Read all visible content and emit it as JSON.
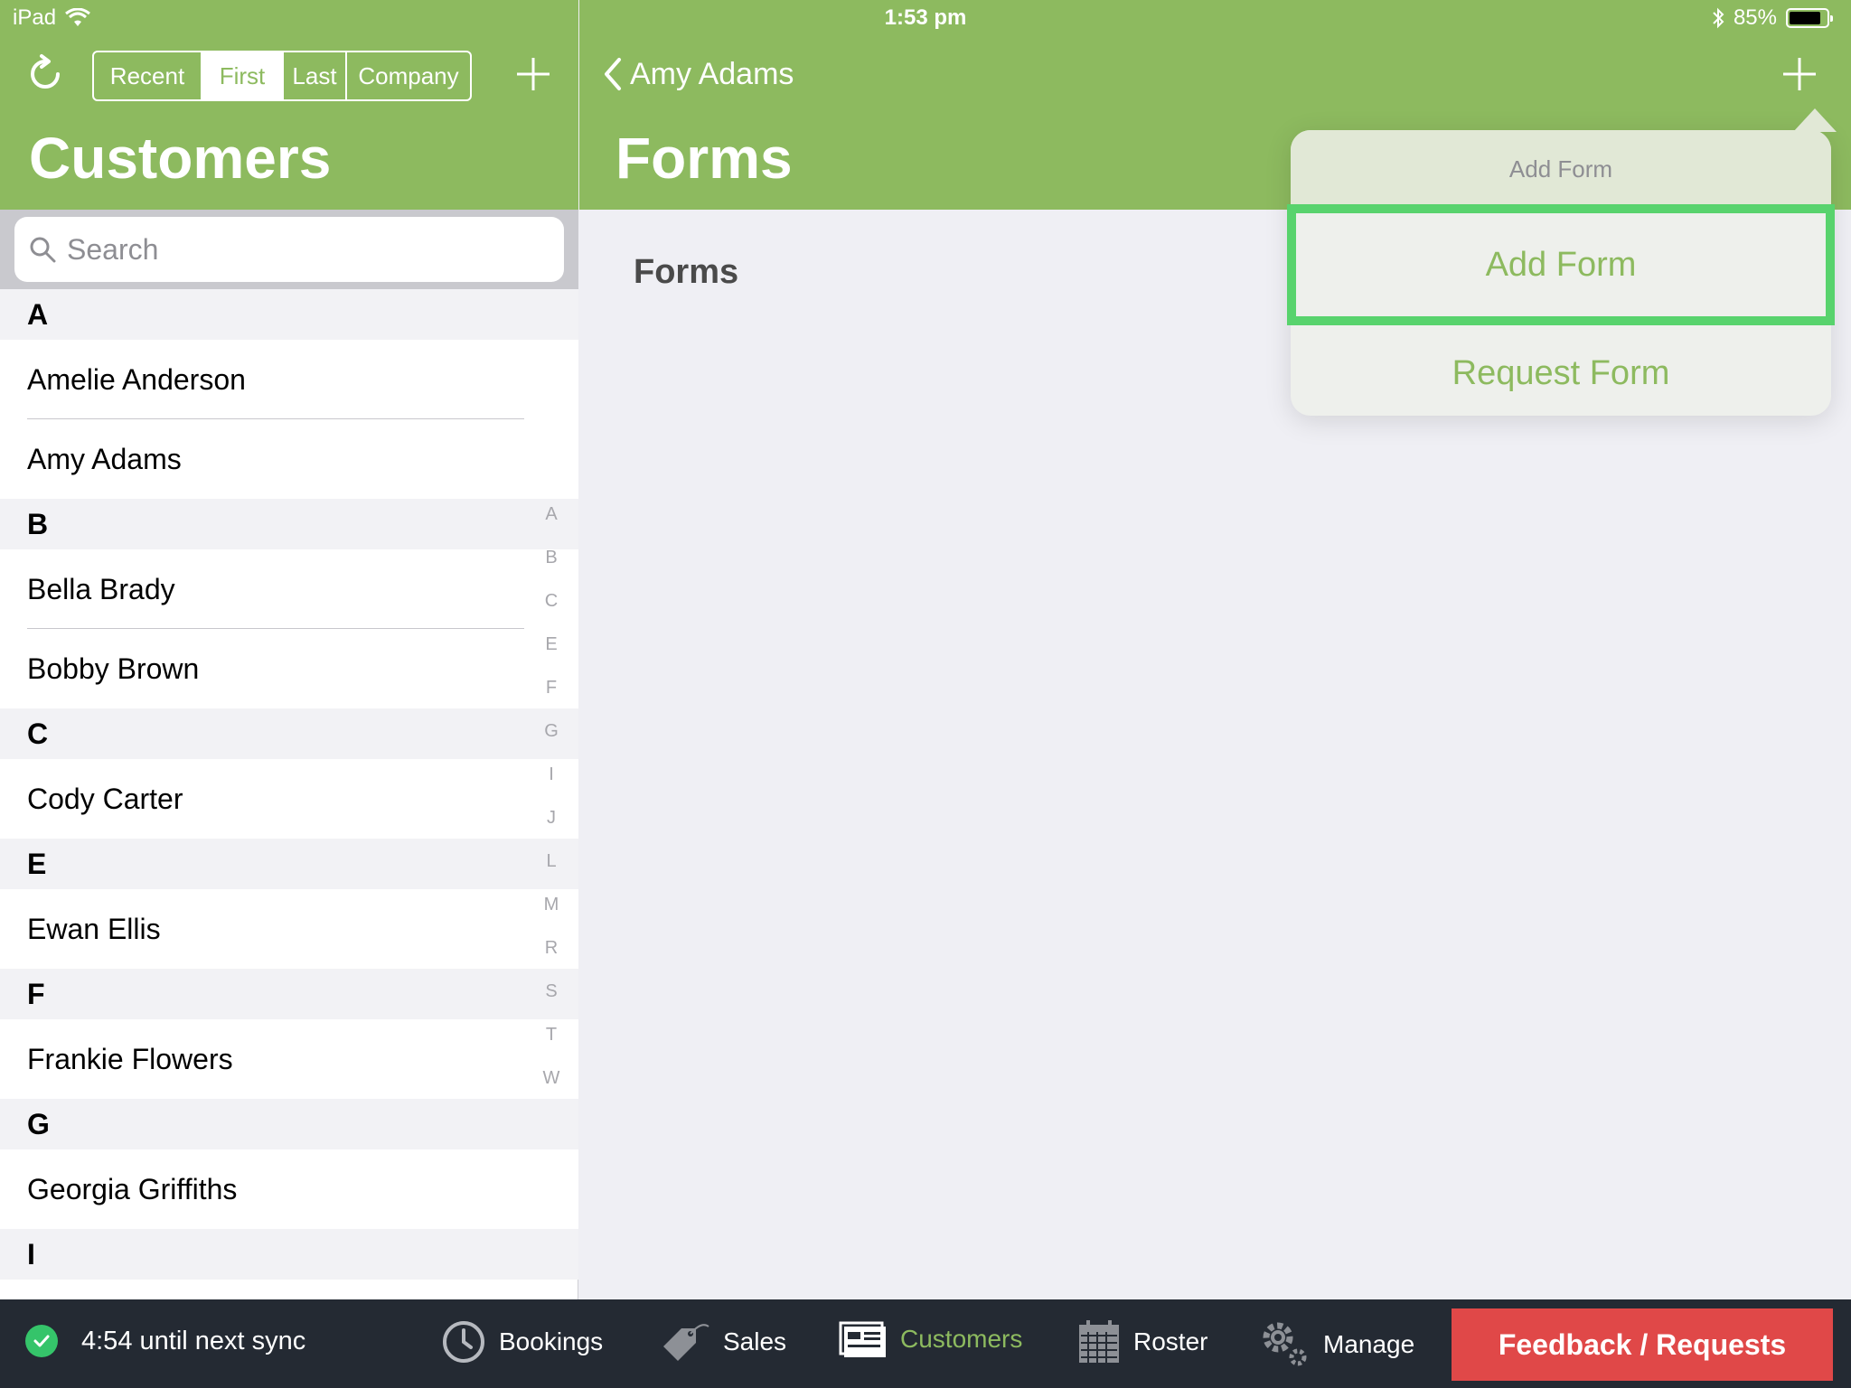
{
  "status_bar": {
    "device": "iPad",
    "time": "1:53 pm",
    "battery_percent": "85%",
    "battery_level": 0.85
  },
  "left": {
    "segments": [
      "Recent",
      "First",
      "Last",
      "Company"
    ],
    "selected_segment": "First",
    "title": "Customers",
    "search_placeholder": "Search",
    "sections": [
      {
        "letter": "A",
        "rows": [
          "Amelie Anderson",
          "Amy Adams"
        ]
      },
      {
        "letter": "B",
        "rows": [
          "Bella Brady",
          "Bobby Brown"
        ]
      },
      {
        "letter": "C",
        "rows": [
          "Cody  Carter"
        ]
      },
      {
        "letter": "E",
        "rows": [
          "Ewan Ellis"
        ]
      },
      {
        "letter": "F",
        "rows": [
          "Frankie Flowers"
        ]
      },
      {
        "letter": "G",
        "rows": [
          "Georgia Griffiths"
        ]
      },
      {
        "letter": "I",
        "rows": []
      }
    ],
    "index_letters": [
      "A",
      "B",
      "C",
      "E",
      "F",
      "G",
      "I",
      "J",
      "L",
      "M",
      "R",
      "S",
      "T",
      "W"
    ]
  },
  "right": {
    "back_label": "Amy Adams",
    "title": "Forms",
    "section_label": "Forms"
  },
  "popover": {
    "title": "Add Form",
    "options": [
      "Add Form",
      "Request Form"
    ]
  },
  "bottom_bar": {
    "sync_text": "4:54 until next sync",
    "tabs": [
      {
        "label": "Bookings",
        "icon": "clock-icon"
      },
      {
        "label": "Sales",
        "icon": "price-tag-icon"
      },
      {
        "label": "Customers",
        "icon": "customers-card-icon"
      },
      {
        "label": "Roster",
        "icon": "calendar-icon"
      },
      {
        "label": "Manage",
        "icon": "gears-icon"
      }
    ],
    "active_tab": "Customers",
    "feedback_label": "Feedback / Requests"
  },
  "colors": {
    "brand_green": "#8dba5f",
    "highlight_green": "#58d36d",
    "feedback_red": "#e04848",
    "bottom_bar_bg": "#242a33"
  }
}
